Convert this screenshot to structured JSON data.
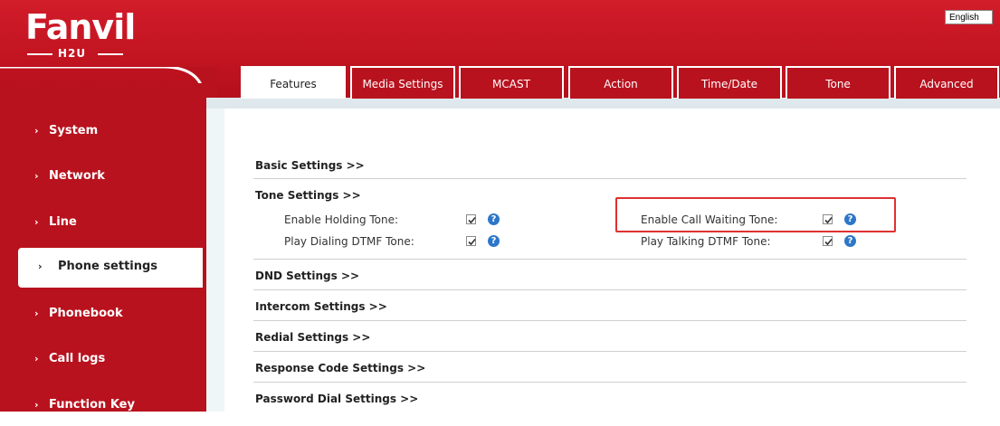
{
  "header": {
    "logo_text": "Fanvil",
    "logo_sub": "H2U",
    "language": "English",
    "colors": {
      "brand_red": "#b8121e",
      "accent_blue": "#2d77c8",
      "highlight_red": "#e03030"
    }
  },
  "tabs": [
    {
      "label": "Features",
      "active": true
    },
    {
      "label": "Media Settings",
      "active": false
    },
    {
      "label": "MCAST",
      "active": false
    },
    {
      "label": "Action",
      "active": false
    },
    {
      "label": "Time/Date",
      "active": false
    },
    {
      "label": "Tone",
      "active": false
    },
    {
      "label": "Advanced",
      "active": false
    }
  ],
  "sidebar": {
    "items": [
      {
        "label": "System",
        "active": false
      },
      {
        "label": "Network",
        "active": false
      },
      {
        "label": "Line",
        "active": false
      },
      {
        "label": "Phone settings",
        "active": true
      },
      {
        "label": "Phonebook",
        "active": false
      },
      {
        "label": "Call logs",
        "active": false
      },
      {
        "label": "Function Key",
        "active": false
      }
    ]
  },
  "sections": [
    {
      "title": "Basic Settings >>"
    },
    {
      "title": "Tone Settings >>"
    },
    {
      "title": "DND Settings >>"
    },
    {
      "title": "Intercom Settings >>"
    },
    {
      "title": "Redial Settings >>"
    },
    {
      "title": "Response Code Settings >>"
    },
    {
      "title": "Password Dial Settings >>"
    }
  ],
  "tone_settings": {
    "enable_holding_tone": {
      "label": "Enable Holding Tone:",
      "checked": true
    },
    "enable_call_waiting_tone": {
      "label": "Enable Call Waiting Tone:",
      "checked": true
    },
    "play_dialing_dtmf_tone": {
      "label": "Play Dialing DTMF Tone:",
      "checked": true
    },
    "play_talking_dtmf_tone": {
      "label": "Play Talking DTMF Tone:",
      "checked": true
    },
    "help_glyph": "?"
  }
}
